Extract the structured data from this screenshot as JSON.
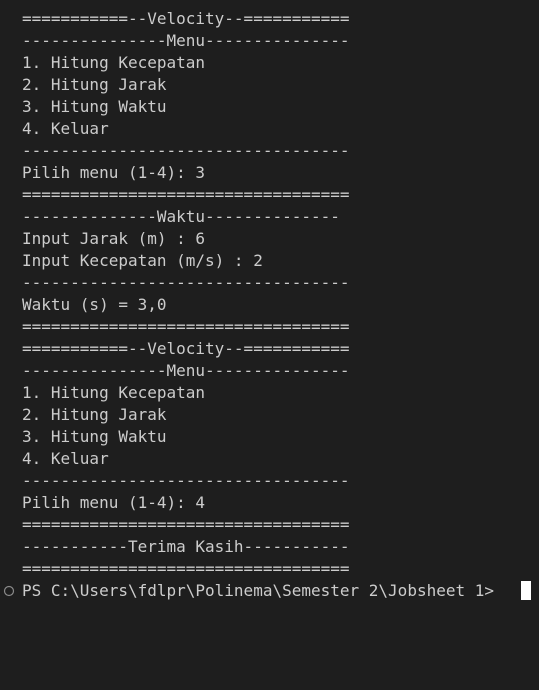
{
  "terminal": {
    "lines": [
      "===========--Velocity--===========",
      "---------------Menu---------------",
      "1. Hitung Kecepatan",
      "2. Hitung Jarak",
      "3. Hitung Waktu",
      "4. Keluar",
      "----------------------------------",
      "Pilih menu (1-4): 3",
      "==================================",
      "--------------Waktu--------------",
      "Input Jarak (m) : 6",
      "Input Kecepatan (m/s) : 2",
      "----------------------------------",
      "Waktu (s) = 3,0",
      "==================================",
      "===========--Velocity--===========",
      "---------------Menu---------------",
      "1. Hitung Kecepatan",
      "2. Hitung Jarak",
      "3. Hitung Waktu",
      "4. Keluar",
      "----------------------------------",
      "Pilih menu (1-4): 4",
      "==================================",
      "-----------Terima Kasih-----------",
      "=================================="
    ],
    "prompt": "PS C:\\Users\\fdlpr\\Polinema\\Semester 2\\Jobsheet 1>",
    "decoration_icon": "circle-outline-icon",
    "colors": {
      "background": "#1e1e1e",
      "foreground": "#cccccc",
      "cursor": "#ffffff"
    }
  }
}
